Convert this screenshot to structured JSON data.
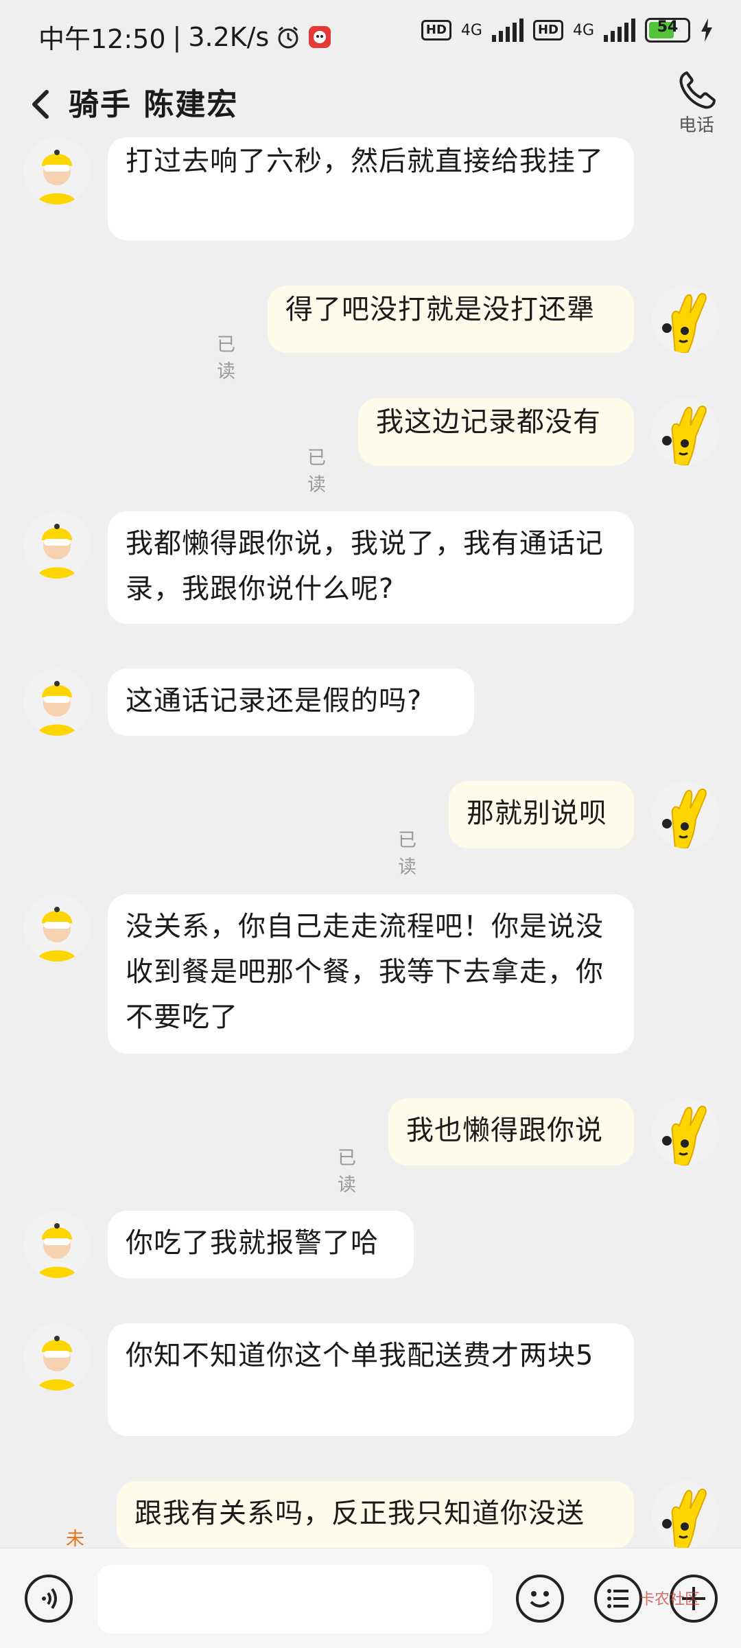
{
  "status_bar": {
    "time": "中午12:50",
    "speed": "3.2K/s",
    "hd1": "HD",
    "net1": "4G",
    "hd2": "HD",
    "net2": "4G",
    "battery": "54"
  },
  "header": {
    "title": "骑手 陈建宏",
    "call_label": "电话"
  },
  "messages": [
    {
      "side": "left",
      "text": "打过去响了六秒，然后就直接给我挂了"
    },
    {
      "side": "right",
      "text": "得了吧没打就是没打还犟",
      "status": "已读"
    },
    {
      "side": "right",
      "text": "我这边记录都没有",
      "status": "已读"
    },
    {
      "side": "left",
      "text": "我都懒得跟你说，我说了，我有通话记录，我跟你说什么呢?"
    },
    {
      "side": "left",
      "text": "这通话记录还是假的吗?"
    },
    {
      "side": "right",
      "text": "那就别说呗",
      "status": "已读"
    },
    {
      "side": "left",
      "text": "没关系，你自己走走流程吧！你是说没收到餐是吧那个餐，我等下去拿走，你不要吃了"
    },
    {
      "side": "right",
      "text": "我也懒得跟你说",
      "status": "已读"
    },
    {
      "side": "left",
      "text": "你吃了我就报警了哈"
    },
    {
      "side": "left",
      "text": "你知不知道你这个单我配送费才两块5"
    },
    {
      "side": "right",
      "text": "跟我有关系吗，反正我只知道你没送",
      "status": "未读"
    }
  ],
  "input_bar": {
    "placeholder": "",
    "watermark": "卡农社区"
  },
  "colors": {
    "background": "#efefef",
    "bubble_other": "#ffffff",
    "bubble_me": "#fffbeb",
    "unread": "#e8751a",
    "read": "#9a9a9a",
    "avatar_yellow": "#ffd500"
  }
}
